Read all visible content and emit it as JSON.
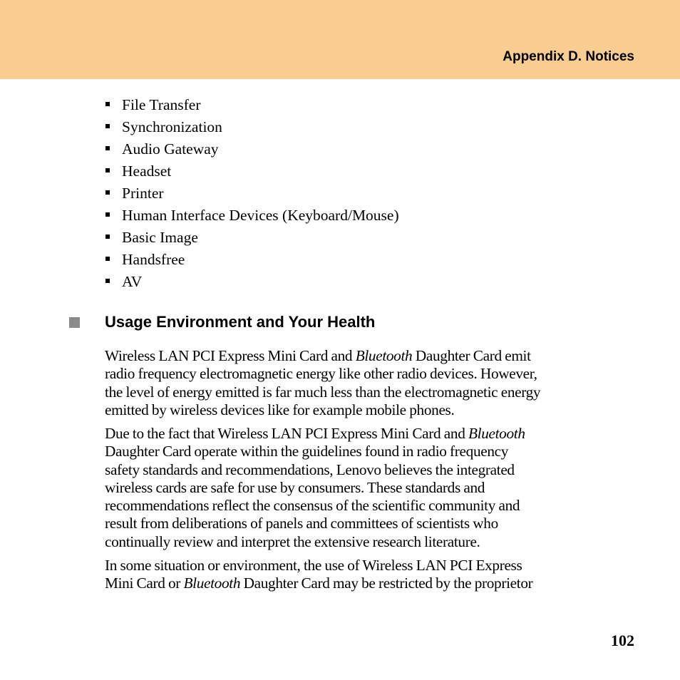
{
  "header": {
    "title": "Appendix D. Notices",
    "background_color": "#f9cc92"
  },
  "profile_list": [
    "File Transfer",
    "Synchronization",
    "Audio Gateway",
    "Headset",
    "Printer",
    "Human Interface Devices (Keyboard/Mouse)",
    "Basic Image",
    "Handsfree",
    "AV"
  ],
  "section": {
    "icon": "gray-square-bullet",
    "title": "Usage Environment and Your Health"
  },
  "paragraphs": [
    {
      "lines": [
        [
          "Wireless LAN PCI Express Mini Card and ",
          "Bluetooth",
          " Daughter Card emit"
        ],
        [
          "radio frequency electromagnetic energy like other radio devices. However,"
        ],
        [
          "the level of energy emitted is far much less than the electromagnetic energy"
        ],
        [
          "emitted by wireless devices like for example mobile phones."
        ]
      ]
    },
    {
      "lines": [
        [
          "Due to the fact that Wireless LAN PCI Express Mini Card and ",
          "Bluetooth",
          ""
        ],
        [
          "Daughter Card operate within the guidelines found in radio frequency"
        ],
        [
          "safety standards and recommendations, Lenovo believes the integrated"
        ],
        [
          "wireless cards are safe for use by consumers. These standards and"
        ],
        [
          "recommendations reflect the consensus of the scientific community and"
        ],
        [
          "result from deliberations of panels and committees of scientists who"
        ],
        [
          "continually review and interpret the extensive research literature."
        ]
      ]
    },
    {
      "lines": [
        [
          "In some situation or environment, the use of Wireless LAN PCI Express"
        ],
        [
          "Mini Card or ",
          "Bluetooth",
          " Daughter Card may be restricted by the proprietor"
        ]
      ]
    }
  ],
  "footer": {
    "page_number": "102"
  }
}
